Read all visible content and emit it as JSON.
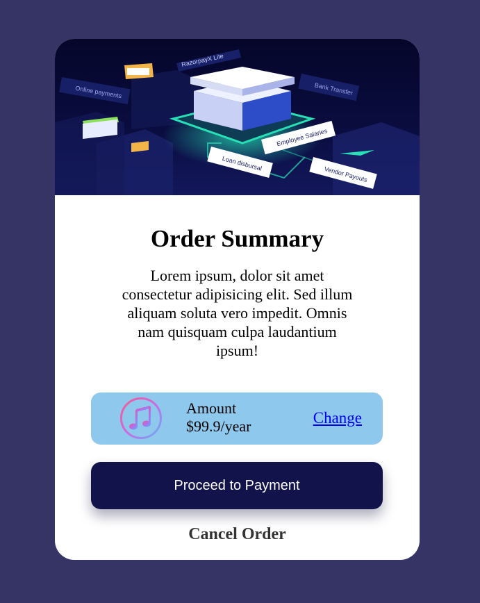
{
  "card": {
    "hero": {
      "illustration": "isometric-payments-illustration",
      "logo_text": "RazorpayX Lite",
      "tags": [
        "Online payments",
        "Bank Transfer",
        "Employee Salaries",
        "Loan disbursal",
        "Vendor Payouts"
      ]
    },
    "title": "Order Summary",
    "description": "Lorem ipsum, dolor sit amet consectetur adipisicing elit. Sed illum aliquam soluta vero impedit. Omnis nam quisquam culpa laudantium ipsum!",
    "plan": {
      "icon": "music-note-icon",
      "label": "Amount",
      "price": "$99.9/year",
      "change_label": "Change"
    },
    "proceed_label": "Proceed to Payment",
    "cancel_label": "Cancel Order"
  },
  "colors": {
    "page_background": "#363464",
    "plan_background": "#8ec8ed",
    "primary_button": "#13134b",
    "link": "#0000ee"
  }
}
